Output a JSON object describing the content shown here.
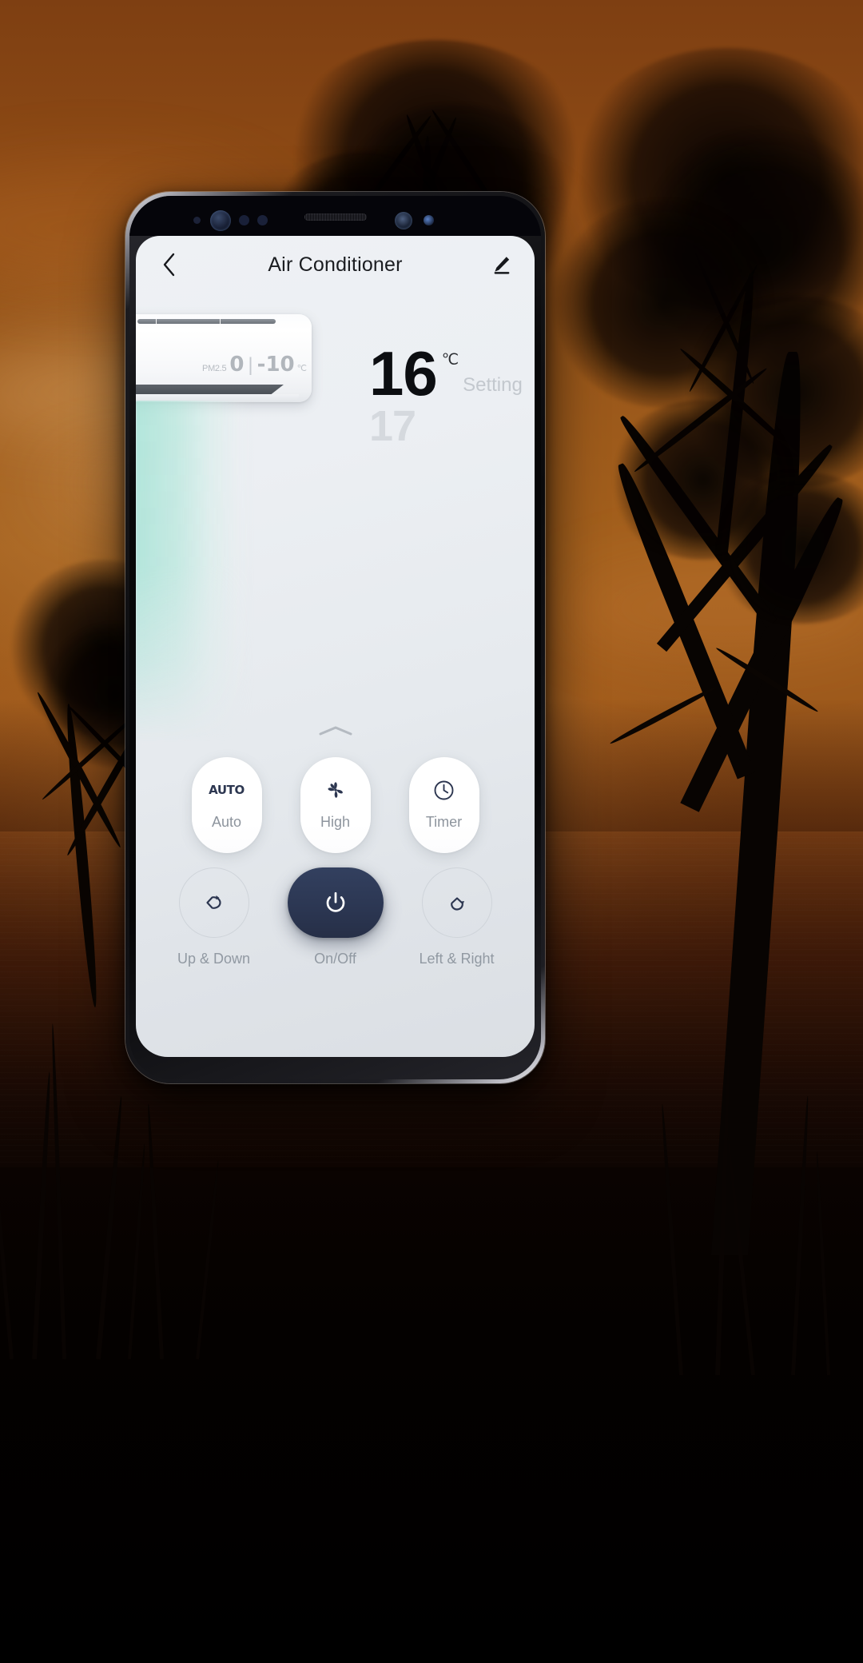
{
  "background": {
    "scene": "sunset-lake-with-tree-silhouettes",
    "sky_color": "#a4601d",
    "ground_color": "#060201"
  },
  "device": {
    "frame": "smartphone-bezel",
    "sensors": [
      "proximity-sensor",
      "front-camera",
      "light-sensor",
      "iris-scanner"
    ]
  },
  "appbar": {
    "title": "Air Conditioner",
    "back_icon": "chevron-left-icon",
    "edit_icon": "pencil-edit-icon"
  },
  "ac_unit": {
    "pm_label": "PM2.5",
    "pm_value": "0",
    "separator": "|",
    "temperature": "-10",
    "temperature_unit": "℃"
  },
  "temperature": {
    "current": "16",
    "unit": "℃",
    "setting_label": "Setting",
    "next": "17"
  },
  "pull_handle": {
    "icon": "chevron-up-icon"
  },
  "modes": [
    {
      "icon": "auto-text-icon",
      "icon_text": "AUTO",
      "label": "Auto"
    },
    {
      "icon": "fan-icon",
      "label": "High"
    },
    {
      "icon": "clock-icon",
      "label": "Timer"
    }
  ],
  "controls": [
    {
      "icon": "swing-left-right-icon",
      "label": "Up & Down",
      "style": "outline"
    },
    {
      "icon": "power-icon",
      "label": "On/Off",
      "style": "filled"
    },
    {
      "icon": "swing-up-down-icon",
      "label": "Left & Right",
      "style": "outline"
    }
  ],
  "colors": {
    "accent_navy": "#2c3753",
    "airflow_mint": "#a3e2d4",
    "screen_bg": "#eceff3",
    "muted_text": "#9199a2"
  }
}
